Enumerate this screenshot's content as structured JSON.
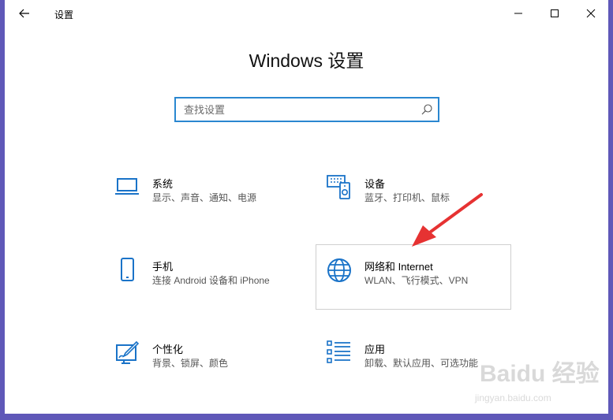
{
  "window": {
    "title": "设置",
    "heading": "Windows 设置"
  },
  "search": {
    "placeholder": "查找设置"
  },
  "tiles": [
    {
      "title": "系统",
      "desc": "显示、声音、通知、电源",
      "icon": "laptop-icon"
    },
    {
      "title": "设备",
      "desc": "蓝牙、打印机、鼠标",
      "icon": "keyboard-device-icon"
    },
    {
      "title": "手机",
      "desc": "连接 Android 设备和 iPhone",
      "icon": "phone-icon"
    },
    {
      "title": "网络和 Internet",
      "desc": "WLAN、飞行模式、VPN",
      "icon": "globe-icon"
    },
    {
      "title": "个性化",
      "desc": "背景、锁屏、颜色",
      "icon": "paint-icon"
    },
    {
      "title": "应用",
      "desc": "卸载、默认应用、可选功能",
      "icon": "apps-list-icon"
    }
  ],
  "watermark": {
    "brand": "Baidu 经验",
    "url": "jingyan.baidu.com"
  },
  "colors": {
    "accent": "#2a87d0",
    "icon": "#1a73c8",
    "annotation_arrow": "#e63232",
    "desktop": "#5f58b8"
  }
}
